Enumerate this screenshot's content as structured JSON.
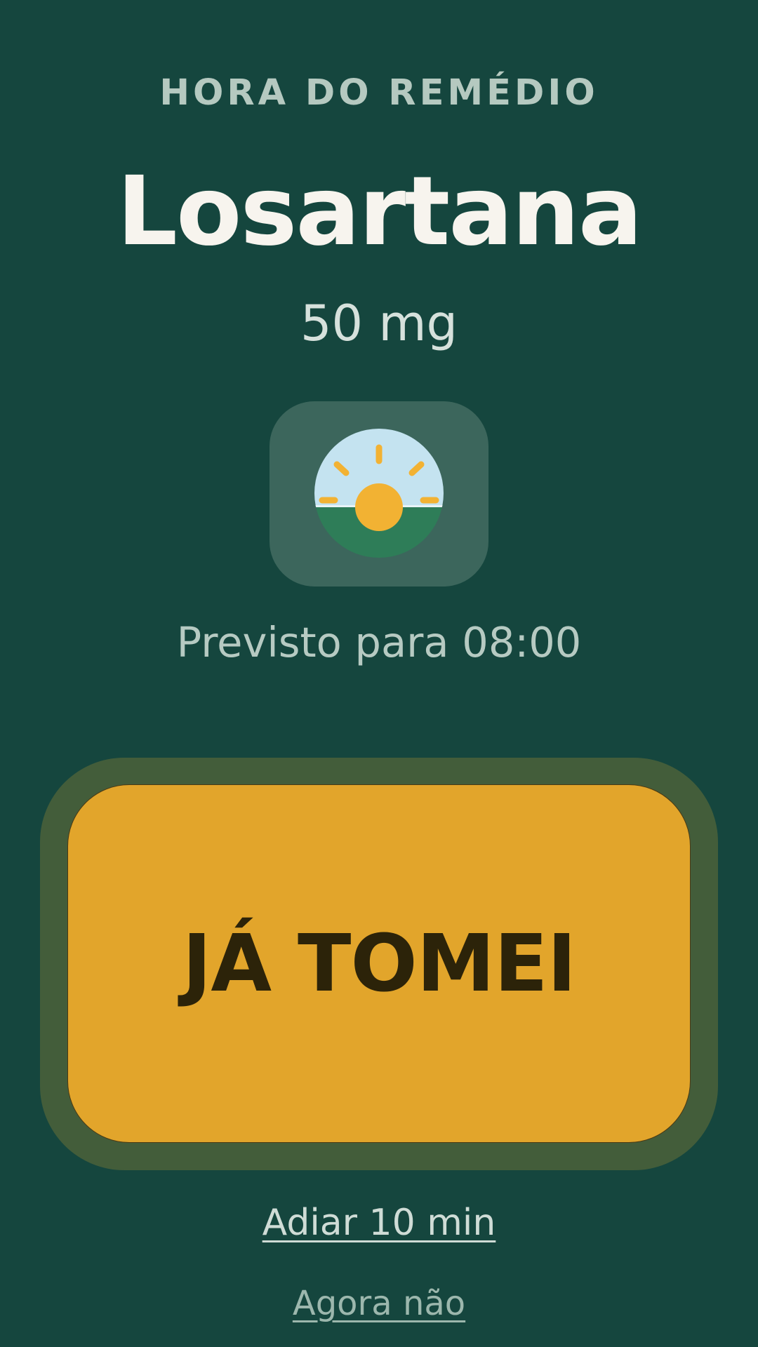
{
  "header": {
    "eyebrow": "HORA DO REMÉDIO"
  },
  "medication": {
    "name": "Losartana",
    "dose": "50 mg",
    "period_icon": "sunrise-icon"
  },
  "schedule": {
    "text": "Previsto para 08:00"
  },
  "actions": {
    "confirm_label": "JÁ TOMEI",
    "snooze_label": "Adiar 10 min",
    "dismiss_label": "Agora não"
  },
  "colors": {
    "background": "#15463e",
    "accent": "#e2a52b",
    "sun": "#f2b233",
    "sky": "#c4e3f0",
    "ground": "#2e7d58"
  }
}
